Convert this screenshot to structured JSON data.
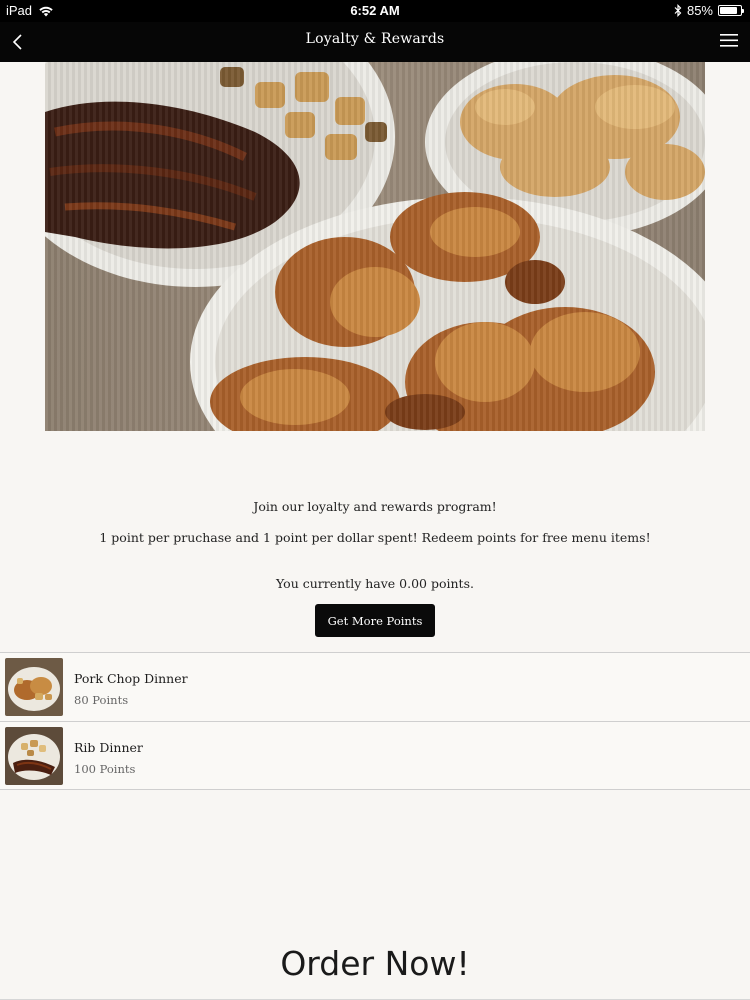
{
  "status_bar": {
    "device": "iPad",
    "time": "6:52 AM",
    "battery": "85%",
    "battery_level": 0.85
  },
  "nav": {
    "title": "Loyalty & Rewards",
    "back_icon": "back-chevron-icon",
    "menu_icon": "hamburger-menu-icon"
  },
  "hero": {
    "image": "hero-food-photo"
  },
  "intro": {
    "heading": "Join our loyalty and rewards program!",
    "description": "1 point per pruchase and 1 point per dollar spent! Redeem points for free menu items!",
    "points_status": "You currently have 0.00 points.",
    "button_label": "Get More Points"
  },
  "rewards": [
    {
      "name": "Pork Chop Dinner",
      "points": "80 Points"
    },
    {
      "name": "Rib Dinner",
      "points": "100 Points"
    }
  ],
  "order_now": "Order Now!",
  "colors": {
    "nav_background": "#060606",
    "page_background": "#f8f6f3",
    "button_background": "#0a0a0a"
  }
}
